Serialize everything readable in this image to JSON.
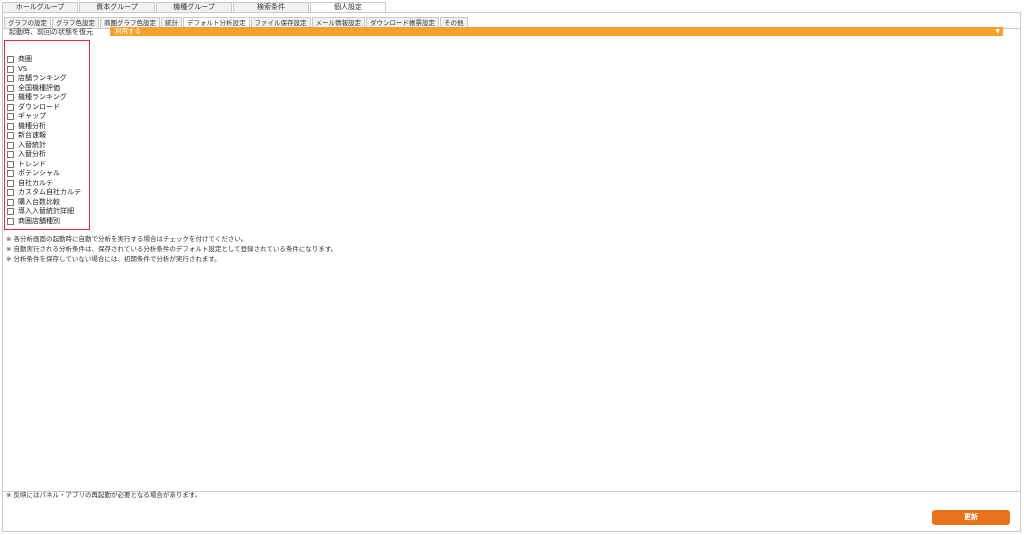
{
  "top_tabs": [
    {
      "label": "ホールグループ"
    },
    {
      "label": "資本グループ"
    },
    {
      "label": "機種グループ"
    },
    {
      "label": "検索条件"
    },
    {
      "label": "個人設定",
      "active": true
    }
  ],
  "sub_tabs": [
    {
      "label": "グラフの設定"
    },
    {
      "label": "グラフ色設定"
    },
    {
      "label": "商圏グラフ色設定"
    },
    {
      "label": "統計"
    },
    {
      "label": "デフォルト分析設定",
      "active": true
    },
    {
      "label": "ファイル保存設定"
    },
    {
      "label": "メール情報設定"
    },
    {
      "label": "ダウンロード帳票設定"
    },
    {
      "label": "その他"
    }
  ],
  "restore": {
    "label": "起動時、前回の状態を復元",
    "value": "利用する"
  },
  "checkboxes": [
    {
      "label": "商圏",
      "checked": false
    },
    {
      "label": "VS",
      "checked": false
    },
    {
      "label": "店舗ランキング",
      "checked": false
    },
    {
      "label": "全国機種評価",
      "checked": false
    },
    {
      "label": "機種ランキング",
      "checked": false
    },
    {
      "label": "ダウンロード",
      "checked": false
    },
    {
      "label": "ギャップ",
      "checked": false
    },
    {
      "label": "機種分析",
      "checked": false
    },
    {
      "label": "新台速報",
      "checked": false
    },
    {
      "label": "入替統計",
      "checked": false
    },
    {
      "label": "入替分析",
      "checked": false
    },
    {
      "label": "トレンド",
      "checked": false
    },
    {
      "label": "ポテンシャル",
      "checked": false
    },
    {
      "label": "自社カルテ",
      "checked": false
    },
    {
      "label": "カスタム自社カルテ",
      "checked": false
    },
    {
      "label": "購入台数比較",
      "checked": false
    },
    {
      "label": "導入入替統計詳細",
      "checked": false
    },
    {
      "label": "商圏店舗種別",
      "checked": false
    }
  ],
  "notes": [
    "※ 各分析画面の起動時に自動で分析を実行する場合はチェックを付けてください。",
    "※ 自動実行される分析条件は、保存されている分析条件のデフォルト設定として登録されている条件になります。",
    "※ 分析条件を保存していない場合には、初期条件で分析が実行されます。"
  ],
  "footer_note": "※ 反映にはパネル・アプリの再起動が必要となる場合があります。",
  "update_button": "更新",
  "colors": {
    "accent_orange": "#f5a12b",
    "button_orange": "#e8731a",
    "group_border_red": "#d0323f"
  }
}
